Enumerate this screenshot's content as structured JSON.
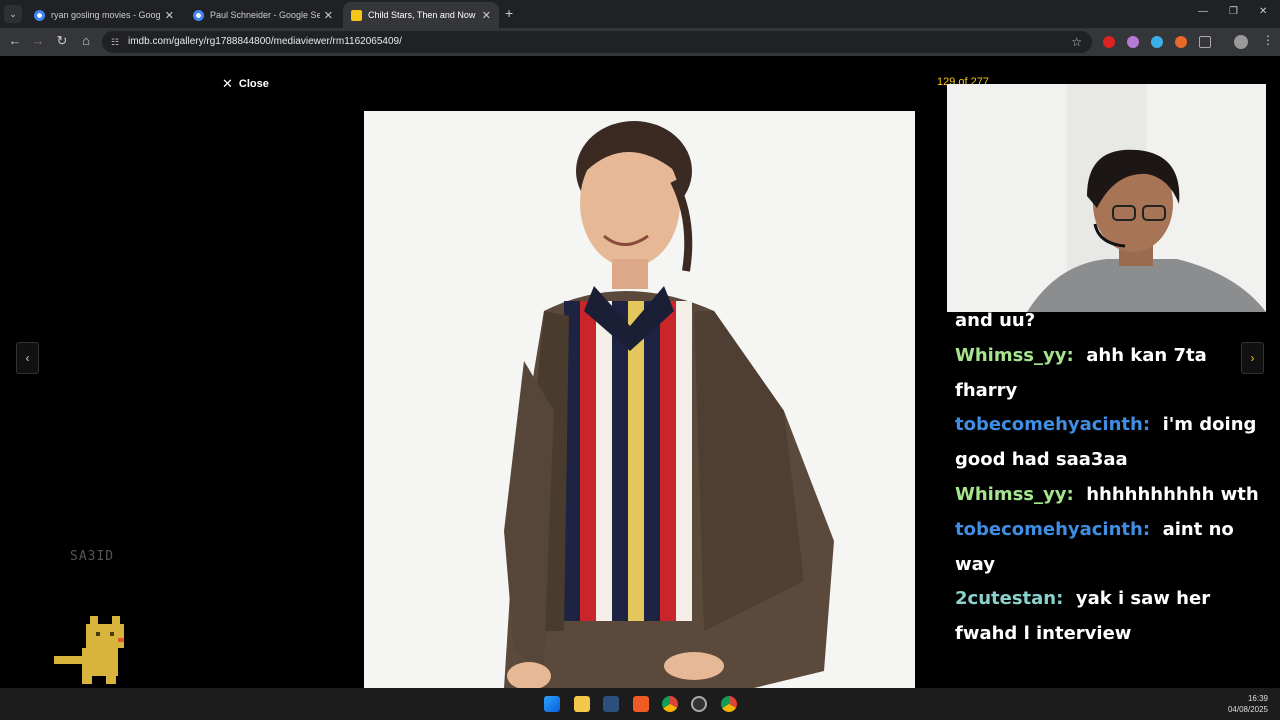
{
  "browser": {
    "tabs": [
      {
        "title": "ryan gosling movies - Google S",
        "favicon": "google-icon"
      },
      {
        "title": "Paul Schneider - Google Search",
        "favicon": "google-icon"
      },
      {
        "title": "Child Stars, Then and Now",
        "favicon": "imdb-icon"
      }
    ],
    "url": "imdb.com/gallery/rg1788844800/mediaviewer/rm1162065409/"
  },
  "viewer": {
    "close_label": "Close",
    "counter": "129 of 277"
  },
  "chat": [
    {
      "user": "",
      "message": "and uu?",
      "color": "white"
    },
    {
      "user": "Whimss_yy:",
      "message": "ahh kan 7ta fharry",
      "color": "#a6e58e"
    },
    {
      "user": "tobecomehyacinth:",
      "message": "i'm doing good had saa3aa",
      "color": "#3f8ee3"
    },
    {
      "user": "Whimss_yy:",
      "message": "hhhhhhhhhh wth",
      "color": "#a6e58e"
    },
    {
      "user": "tobecomehyacinth:",
      "message": "aint no way",
      "color": "#3f8ee3"
    },
    {
      "user": "2cutestan:",
      "message": "yak i saw her fwahd l interview",
      "color": "#8ad2ce"
    }
  ],
  "overlay": {
    "watermark": "SA3ID"
  },
  "taskbar": {
    "time": "16:39",
    "date": "04/08/2025"
  }
}
